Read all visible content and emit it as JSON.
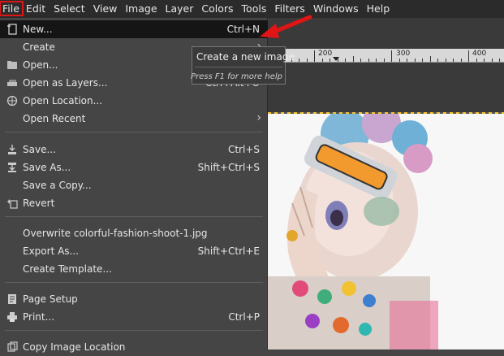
{
  "menubar": {
    "items": [
      "File",
      "Edit",
      "Select",
      "View",
      "Image",
      "Layer",
      "Colors",
      "Tools",
      "Filters",
      "Windows",
      "Help"
    ]
  },
  "file_menu": {
    "items": [
      {
        "label": "New...",
        "accel": "Ctrl+N",
        "icon": "new-image-icon"
      },
      {
        "label": "Create",
        "submenu": true
      },
      {
        "label": "Open...",
        "icon": "open-icon"
      },
      {
        "label": "Open as Layers...",
        "accel": "Ctrl+Alt+O",
        "icon": "open-layers-icon"
      },
      {
        "label": "Open Location...",
        "icon": "open-location-icon"
      },
      {
        "label": "Open Recent",
        "submenu": true
      },
      {
        "label": "Save...",
        "accel": "Ctrl+S",
        "icon": "save-icon"
      },
      {
        "label": "Save As...",
        "accel": "Shift+Ctrl+S",
        "icon": "save-as-icon"
      },
      {
        "label": "Save a Copy..."
      },
      {
        "label": "Revert",
        "icon": "revert-icon"
      },
      {
        "label": "Overwrite colorful-fashion-shoot-1.jpg"
      },
      {
        "label": "Export As...",
        "accel": "Shift+Ctrl+E"
      },
      {
        "label": "Create Template..."
      },
      {
        "label": "Page Setup",
        "icon": "page-setup-icon"
      },
      {
        "label": "Print...",
        "accel": "Ctrl+P",
        "icon": "print-icon"
      },
      {
        "label": "Copy Image Location"
      }
    ]
  },
  "tooltip": {
    "title": "Create a new image",
    "hint": "Press F1 for more help"
  },
  "ruler": {
    "labels": [
      "200",
      "300",
      "400"
    ]
  },
  "colors": {
    "highlight_border": "#e01515",
    "arrow": "#e01515",
    "selection_dash": "#f2c230"
  }
}
